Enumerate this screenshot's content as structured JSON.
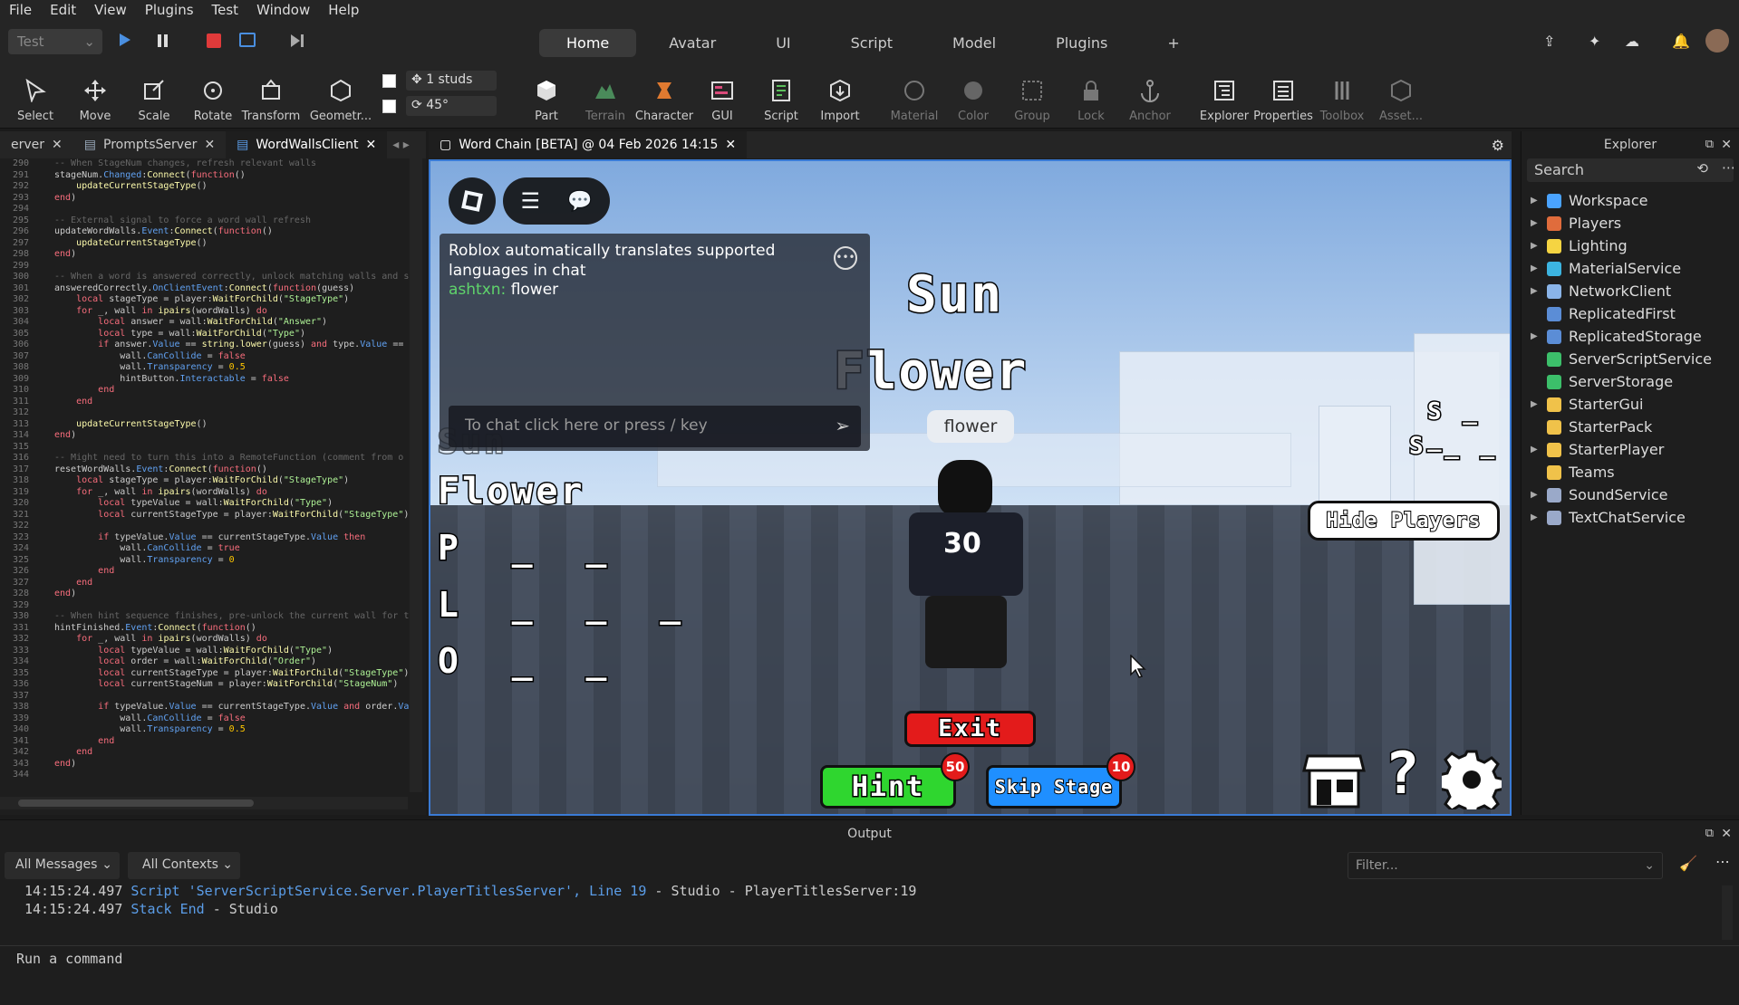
{
  "menu": [
    "File",
    "Edit",
    "View",
    "Plugins",
    "Test",
    "Window",
    "Help"
  ],
  "mode_select": "Test",
  "ribbon_tabs": [
    {
      "label": "Home",
      "active": true
    },
    {
      "label": "Avatar",
      "active": false
    },
    {
      "label": "UI",
      "active": false
    },
    {
      "label": "Script",
      "active": false
    },
    {
      "label": "Model",
      "active": false
    },
    {
      "label": "Plugins",
      "active": false
    }
  ],
  "tools": [
    "Select",
    "Move",
    "Scale",
    "Rotate",
    "Transform",
    "Geometr...",
    "Part",
    "Terrain",
    "Character",
    "GUI",
    "Script",
    "Import",
    "Material",
    "Color",
    "Group",
    "Lock",
    "Anchor",
    "Explorer",
    "Properties",
    "Toolbox",
    "Asset..."
  ],
  "snap": {
    "move": "1 studs",
    "rotate": "45°"
  },
  "doc_tabs": [
    {
      "label": "erver"
    },
    {
      "label": "PromptsServer"
    },
    {
      "label": "WordWallsClient",
      "active": true
    }
  ],
  "viewport_tab": "Word Chain [BETA] @ 04 Feb 2026 14:15",
  "code": {
    "line_numbers": [
      "290",
      "291",
      "292",
      "293",
      "294",
      "295",
      "296",
      "297",
      "298",
      "299",
      "300",
      "301",
      "302",
      "303",
      "304",
      "305",
      "306",
      "307",
      "308",
      "309",
      "310",
      "311",
      "312",
      "313",
      "314",
      "315",
      "316",
      "317",
      "318",
      "319",
      "320",
      "321",
      "322",
      "323",
      "324",
      "325",
      "326",
      "327",
      "328",
      "329",
      "330",
      "331",
      "332",
      "333",
      "334",
      "335",
      "336",
      "337",
      "338",
      "339",
      "340",
      "341",
      "342",
      "343",
      "344"
    ]
  },
  "game": {
    "chat_notice": "Roblox automatically translates supported languages in chat",
    "chat_user": "ashtxn:",
    "chat_msg": "flower",
    "chat_placeholder": "To chat click here or press / key",
    "bubble": "flower",
    "wall_word1": "Sun",
    "wall_word2": "Flower",
    "left_word1": "Sun",
    "left_word2": "Flower",
    "left_p": "P _ _",
    "left_l": "L _ _ _",
    "left_o": "O _ _",
    "hide_players": "Hide Players",
    "exit": "Exit",
    "hint": "Hint",
    "hint_cost": "50",
    "skip": "Skip Stage",
    "skip_cost": "10",
    "jersey": "30",
    "right_s1": "S _ _",
    "right_s2": "S _ _"
  },
  "explorer": {
    "title": "Explorer",
    "search_placeholder": "Search",
    "items": [
      {
        "label": "Workspace",
        "expand": true,
        "color": "#4aa3ff"
      },
      {
        "label": "Players",
        "expand": true,
        "color": "#e06c3c"
      },
      {
        "label": "Lighting",
        "expand": true,
        "color": "#f5d442"
      },
      {
        "label": "MaterialService",
        "expand": true,
        "color": "#3cb4e0"
      },
      {
        "label": "NetworkClient",
        "expand": true,
        "color": "#8ab4e8"
      },
      {
        "label": "ReplicatedFirst",
        "expand": false,
        "color": "#5b8dd6"
      },
      {
        "label": "ReplicatedStorage",
        "expand": true,
        "color": "#5b8dd6"
      },
      {
        "label": "ServerScriptService",
        "expand": false,
        "color": "#3cbf6a"
      },
      {
        "label": "ServerStorage",
        "expand": false,
        "color": "#3cbf6a"
      },
      {
        "label": "StarterGui",
        "expand": true,
        "color": "#f0c24a"
      },
      {
        "label": "StarterPack",
        "expand": false,
        "color": "#f0c24a"
      },
      {
        "label": "StarterPlayer",
        "expand": true,
        "color": "#f0c24a"
      },
      {
        "label": "Teams",
        "expand": false,
        "color": "#f0c24a"
      },
      {
        "label": "SoundService",
        "expand": true,
        "color": "#9aa9c9"
      },
      {
        "label": "TextChatService",
        "expand": true,
        "color": "#9aa9c9"
      }
    ]
  },
  "output": {
    "title": "Output",
    "filter1": "All Messages",
    "filter2": "All Contexts",
    "filter_placeholder": "Filter...",
    "lines": [
      {
        "time": "14:15:24.497",
        "msg": "Script 'ServerScriptService.Server.PlayerTitlesServer', Line 19",
        "src": "-  Studio - PlayerTitlesServer:19"
      },
      {
        "time": "14:15:24.497",
        "msg": "Stack End",
        "src": "-  Studio"
      }
    ],
    "command_placeholder": "Run a command"
  }
}
